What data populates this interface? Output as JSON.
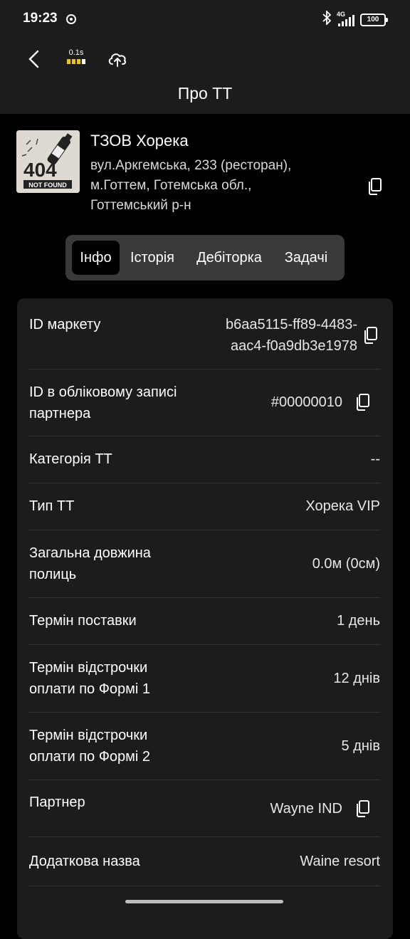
{
  "status": {
    "time": "19:23",
    "network": "4G",
    "battery": "100"
  },
  "toolbar": {
    "sync_label": "0.1s"
  },
  "page": {
    "title": "Про ТТ"
  },
  "store": {
    "logo_text_top": "404",
    "logo_text_bottom": "NOT FOUND",
    "name": "ТЗОВ Хорека",
    "address": "вул.Аркгемська, 233 (ресторан), м.Готтем, Готемська обл., Готтемський р-н"
  },
  "tabs": [
    {
      "label": "Інфо",
      "active": true
    },
    {
      "label": "Історія",
      "active": false
    },
    {
      "label": "Дебіторка",
      "active": false
    },
    {
      "label": "Задачі",
      "active": false
    }
  ],
  "info_rows": [
    {
      "label": "ID маркету",
      "value": "b6aa5115-ff89-4483-aac4-f0a9db3e1978",
      "copyable": true
    },
    {
      "label": "ID в обліковому записі партнера",
      "value": "#00000010",
      "copyable": true
    },
    {
      "label": "Категорія ТТ",
      "value": "--",
      "copyable": false
    },
    {
      "label": "Тип ТТ",
      "value": "Хорека VIP",
      "copyable": false
    },
    {
      "label": "Загальна довжина полиць",
      "value": "0.0м (0см)",
      "copyable": false
    },
    {
      "label": "Термін поставки",
      "value": "1 день",
      "copyable": false
    },
    {
      "label": "Термін відстрочки оплати по Формі 1",
      "value": "12 днів",
      "copyable": false
    },
    {
      "label": "Термін відстрочки оплати по Формі 2",
      "value": "5 днів",
      "copyable": false
    },
    {
      "label": "Партнер",
      "value": "Wayne IND",
      "copyable": true
    },
    {
      "label": "Додаткова назва",
      "value": "Waine resort",
      "copyable": false
    }
  ],
  "colors": {
    "background": "#000000",
    "surface": "#1c1c1c",
    "tab_bar": "#3a3a3a",
    "accent_yellow": "#e8c21c"
  }
}
